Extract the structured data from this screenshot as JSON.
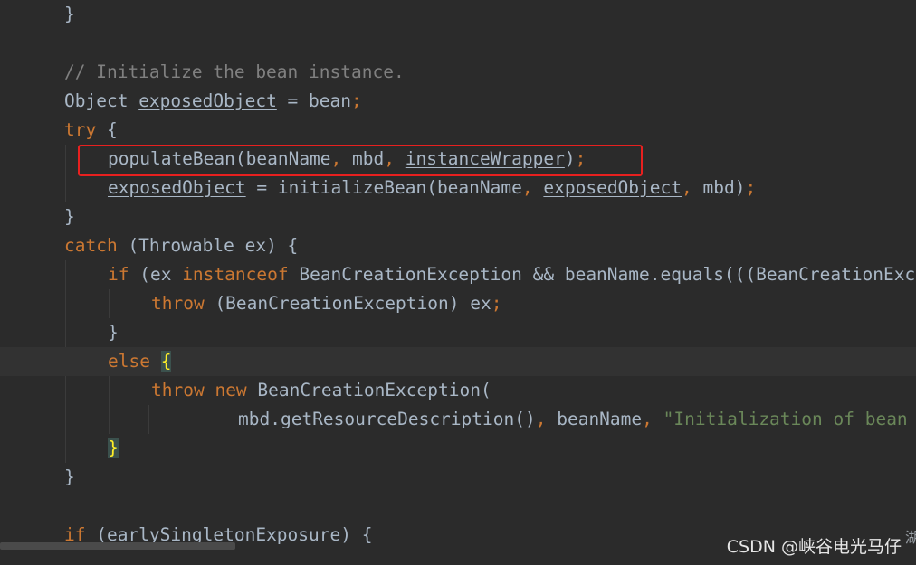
{
  "editor": {
    "language": "java",
    "colors": {
      "background": "#2b2b2b",
      "caret_line": "#323232",
      "keyword": "#cc7832",
      "comment": "#808080",
      "string": "#6a8759",
      "text": "#a9b7c6",
      "highlight_box": "#e8201f"
    },
    "lines": {
      "l1_close": "}",
      "l3_comment": "// Initialize the bean instance.",
      "l4_type": "Object ",
      "l4_var": "exposedObject",
      "l4_rest": " = bean",
      "l4_semi": ";",
      "l5_kw": "try",
      "l5_brace": " {",
      "l6_call": "populateBean(beanName",
      "l6_c1": ",",
      "l6_arg2": " mbd",
      "l6_c2": ",",
      "l6_sp": " ",
      "l6_arg3": "instanceWrapper",
      "l6_close": ")",
      "l6_semi": ";",
      "l7_var": "exposedObject",
      "l7_mid": " = initializeBean(beanName",
      "l7_c1": ",",
      "l7_sp": " ",
      "l7_arg2": "exposedObject",
      "l7_c2": ",",
      "l7_arg3": " mbd)",
      "l7_semi": ";",
      "l8_close": "}",
      "l9_kw": "catch",
      "l9_rest": " (Throwable ex) {",
      "l10_kw1": "if",
      "l10_a": " (ex ",
      "l10_kw2": "instanceof",
      "l10_b": " BeanCreationException && beanName.equals(((BeanCreationException) ex).getBeanName())) {",
      "l11_kw": "throw",
      "l11_rest": " (BeanCreationException) ex",
      "l11_semi": ";",
      "l12_close": "}",
      "l13_kw": "else",
      "l13_sp": " ",
      "l13_brace": "{",
      "l14_kw1": "throw",
      "l14_sp": " ",
      "l14_kw2": "new",
      "l14_rest": " BeanCreationException(",
      "l15_a": "mbd.getResourceDescription()",
      "l15_c1": ",",
      "l15_b": " beanName",
      "l15_c2": ",",
      "l15_sp": " ",
      "l15_str": "\"Initialization of bean failed\", ex);",
      "l16_brace": "}",
      "l17_close": "}",
      "l19_kw": "if",
      "l19_rest": " (earlySingletonExposure) {"
    }
  },
  "watermark": {
    "text": "CSDN @峡谷电光马仔",
    "edge_glyph": "湖"
  }
}
